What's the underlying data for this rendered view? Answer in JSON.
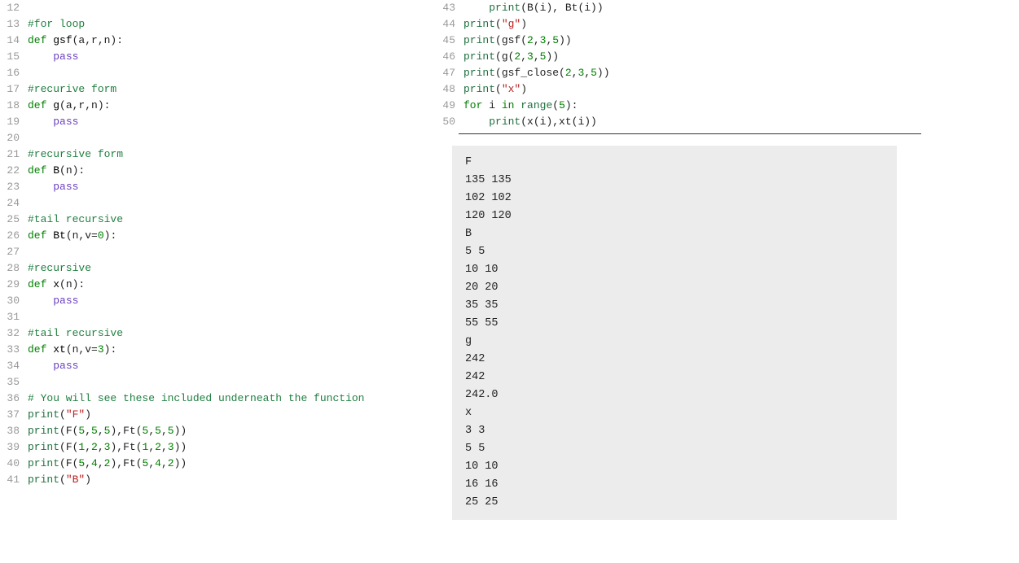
{
  "leftCode": [
    {
      "n": "12",
      "t": []
    },
    {
      "n": "13",
      "t": [
        [
          "comment",
          "#for loop"
        ]
      ]
    },
    {
      "n": "14",
      "t": [
        [
          "kw",
          "def "
        ],
        [
          "fn",
          "gsf"
        ],
        [
          "plain",
          "(a,r,n):"
        ]
      ]
    },
    {
      "n": "15",
      "t": [
        [
          "plain",
          "    "
        ],
        [
          "pass",
          "pass"
        ]
      ]
    },
    {
      "n": "16",
      "t": []
    },
    {
      "n": "17",
      "t": [
        [
          "comment",
          "#recurive form"
        ]
      ]
    },
    {
      "n": "18",
      "t": [
        [
          "kw",
          "def "
        ],
        [
          "fn",
          "g"
        ],
        [
          "plain",
          "(a,r,n):"
        ]
      ]
    },
    {
      "n": "19",
      "t": [
        [
          "plain",
          "    "
        ],
        [
          "pass",
          "pass"
        ]
      ]
    },
    {
      "n": "20",
      "t": []
    },
    {
      "n": "21",
      "t": [
        [
          "comment",
          "#recursive form"
        ]
      ]
    },
    {
      "n": "22",
      "t": [
        [
          "kw",
          "def "
        ],
        [
          "fn",
          "B"
        ],
        [
          "plain",
          "(n):"
        ]
      ]
    },
    {
      "n": "23",
      "t": [
        [
          "plain",
          "    "
        ],
        [
          "pass",
          "pass"
        ]
      ]
    },
    {
      "n": "24",
      "t": []
    },
    {
      "n": "25",
      "t": [
        [
          "comment",
          "#tail recursive"
        ]
      ]
    },
    {
      "n": "26",
      "t": [
        [
          "kw",
          "def "
        ],
        [
          "fn",
          "Bt"
        ],
        [
          "plain",
          "(n,v="
        ],
        [
          "num",
          "0"
        ],
        [
          "plain",
          "):"
        ]
      ]
    },
    {
      "n": "27",
      "t": []
    },
    {
      "n": "28",
      "t": [
        [
          "comment",
          "#recursive"
        ]
      ]
    },
    {
      "n": "29",
      "t": [
        [
          "kw",
          "def "
        ],
        [
          "fn",
          "x"
        ],
        [
          "plain",
          "(n):"
        ]
      ]
    },
    {
      "n": "30",
      "t": [
        [
          "plain",
          "    "
        ],
        [
          "pass",
          "pass"
        ]
      ]
    },
    {
      "n": "31",
      "t": []
    },
    {
      "n": "32",
      "t": [
        [
          "comment",
          "#tail recursive"
        ]
      ]
    },
    {
      "n": "33",
      "t": [
        [
          "kw",
          "def "
        ],
        [
          "fn",
          "xt"
        ],
        [
          "plain",
          "(n,v="
        ],
        [
          "num",
          "3"
        ],
        [
          "plain",
          "):"
        ]
      ]
    },
    {
      "n": "34",
      "t": [
        [
          "plain",
          "    "
        ],
        [
          "pass",
          "pass"
        ]
      ]
    },
    {
      "n": "35",
      "t": []
    },
    {
      "n": "36",
      "t": [
        [
          "comment",
          "# You will see these included underneath the function"
        ]
      ]
    },
    {
      "n": "37",
      "t": [
        [
          "builtin",
          "print"
        ],
        [
          "plain",
          "("
        ],
        [
          "str",
          "\"F\""
        ],
        [
          "plain",
          ")"
        ]
      ]
    },
    {
      "n": "38",
      "t": [
        [
          "builtin",
          "print"
        ],
        [
          "plain",
          "(F("
        ],
        [
          "num",
          "5"
        ],
        [
          "plain",
          ","
        ],
        [
          "num",
          "5"
        ],
        [
          "plain",
          ","
        ],
        [
          "num",
          "5"
        ],
        [
          "plain",
          "),Ft("
        ],
        [
          "num",
          "5"
        ],
        [
          "plain",
          ","
        ],
        [
          "num",
          "5"
        ],
        [
          "plain",
          ","
        ],
        [
          "num",
          "5"
        ],
        [
          "plain",
          "))"
        ]
      ]
    },
    {
      "n": "39",
      "t": [
        [
          "builtin",
          "print"
        ],
        [
          "plain",
          "(F("
        ],
        [
          "num",
          "1"
        ],
        [
          "plain",
          ","
        ],
        [
          "num",
          "2"
        ],
        [
          "plain",
          ","
        ],
        [
          "num",
          "3"
        ],
        [
          "plain",
          "),Ft("
        ],
        [
          "num",
          "1"
        ],
        [
          "plain",
          ","
        ],
        [
          "num",
          "2"
        ],
        [
          "plain",
          ","
        ],
        [
          "num",
          "3"
        ],
        [
          "plain",
          "))"
        ]
      ]
    },
    {
      "n": "40",
      "t": [
        [
          "builtin",
          "print"
        ],
        [
          "plain",
          "(F("
        ],
        [
          "num",
          "5"
        ],
        [
          "plain",
          ","
        ],
        [
          "num",
          "4"
        ],
        [
          "plain",
          ","
        ],
        [
          "num",
          "2"
        ],
        [
          "plain",
          "),Ft("
        ],
        [
          "num",
          "5"
        ],
        [
          "plain",
          ","
        ],
        [
          "num",
          "4"
        ],
        [
          "plain",
          ","
        ],
        [
          "num",
          "2"
        ],
        [
          "plain",
          "))"
        ]
      ]
    },
    {
      "n": "41",
      "t": [
        [
          "builtin",
          "print"
        ],
        [
          "plain",
          "("
        ],
        [
          "str",
          "\"B\""
        ],
        [
          "plain",
          ")"
        ]
      ]
    }
  ],
  "rightCode": [
    {
      "n": "43",
      "t": [
        [
          "plain",
          "    "
        ],
        [
          "builtin",
          "print"
        ],
        [
          "plain",
          "(B(i), Bt(i))"
        ]
      ]
    },
    {
      "n": "44",
      "t": [
        [
          "builtin",
          "print"
        ],
        [
          "plain",
          "("
        ],
        [
          "str",
          "\"g\""
        ],
        [
          "plain",
          ")"
        ]
      ]
    },
    {
      "n": "45",
      "t": [
        [
          "builtin",
          "print"
        ],
        [
          "plain",
          "(gsf("
        ],
        [
          "num",
          "2"
        ],
        [
          "plain",
          ","
        ],
        [
          "num",
          "3"
        ],
        [
          "plain",
          ","
        ],
        [
          "num",
          "5"
        ],
        [
          "plain",
          "))"
        ]
      ]
    },
    {
      "n": "46",
      "t": [
        [
          "builtin",
          "print"
        ],
        [
          "plain",
          "(g("
        ],
        [
          "num",
          "2"
        ],
        [
          "plain",
          ","
        ],
        [
          "num",
          "3"
        ],
        [
          "plain",
          ","
        ],
        [
          "num",
          "5"
        ],
        [
          "plain",
          "))"
        ]
      ]
    },
    {
      "n": "47",
      "t": [
        [
          "builtin",
          "print"
        ],
        [
          "plain",
          "(gsf_close("
        ],
        [
          "num",
          "2"
        ],
        [
          "plain",
          ","
        ],
        [
          "num",
          "3"
        ],
        [
          "plain",
          ","
        ],
        [
          "num",
          "5"
        ],
        [
          "plain",
          "))"
        ]
      ]
    },
    {
      "n": "48",
      "t": [
        [
          "builtin",
          "print"
        ],
        [
          "plain",
          "("
        ],
        [
          "str",
          "\"x\""
        ],
        [
          "plain",
          ")"
        ]
      ]
    },
    {
      "n": "49",
      "t": [
        [
          "kw",
          "for "
        ],
        [
          "plain",
          "i "
        ],
        [
          "kw",
          "in "
        ],
        [
          "builtin",
          "range"
        ],
        [
          "plain",
          "("
        ],
        [
          "num",
          "5"
        ],
        [
          "plain",
          "):"
        ]
      ]
    },
    {
      "n": "50",
      "t": [
        [
          "plain",
          "    "
        ],
        [
          "builtin",
          "print"
        ],
        [
          "plain",
          "(x(i),xt(i))"
        ]
      ]
    }
  ],
  "output": "F\n135 135\n102 102\n120 120\nB\n5 5\n10 10\n20 20\n35 35\n55 55\ng\n242\n242\n242.0\nx\n3 3\n5 5\n10 10\n16 16\n25 25"
}
